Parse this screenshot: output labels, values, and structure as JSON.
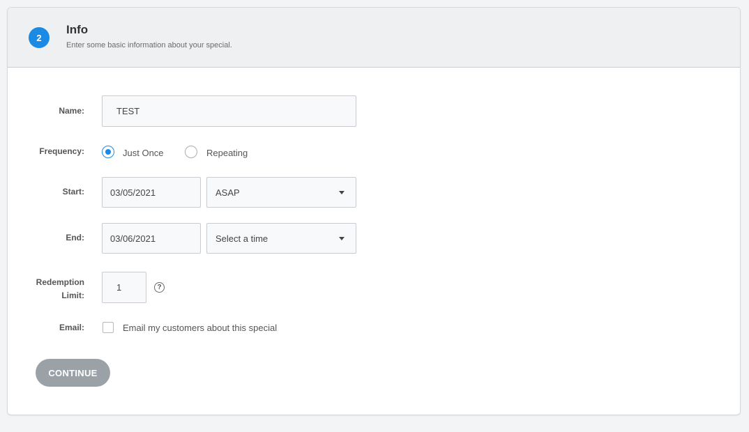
{
  "header": {
    "step_number": "2",
    "title": "Info",
    "subtitle": "Enter some basic information about your special."
  },
  "form": {
    "name": {
      "label": "Name:",
      "value": "TEST"
    },
    "frequency": {
      "label": "Frequency:",
      "options": [
        "Just Once",
        "Repeating"
      ],
      "selected": "Just Once"
    },
    "start": {
      "label": "Start:",
      "date": "03/05/2021",
      "time_selected": "ASAP"
    },
    "end": {
      "label": "End:",
      "date": "03/06/2021",
      "time_placeholder": "Select a time"
    },
    "redemption_limit": {
      "label_line1": "Redemption",
      "label_line2": "Limit:",
      "value": "1",
      "help_icon": "question-circle-icon"
    },
    "email": {
      "label": "Email:",
      "checkbox_label": "Email my customers about this special",
      "checked": false
    }
  },
  "actions": {
    "continue_label": "CONTINUE"
  },
  "colors": {
    "accent": "#1a8ae5",
    "header_bg": "#eef0f2",
    "button_bg": "#9aa1a7"
  }
}
